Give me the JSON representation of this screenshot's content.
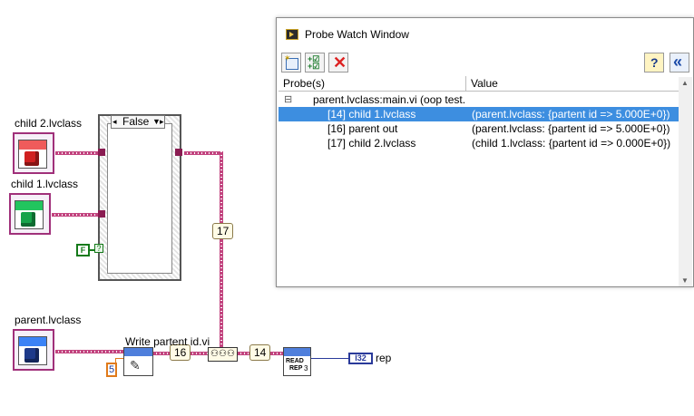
{
  "diagram": {
    "class_labels": {
      "child2": "child 2.lvclass",
      "child1": "child 1.lvclass",
      "parent": "parent.lvclass"
    },
    "case_selector": "False",
    "bool_const": "F",
    "num_const": "5",
    "subvi_label": "Write partent id.vi",
    "probes": {
      "p17": "17",
      "p16": "16",
      "p14": "14"
    },
    "read_rep": {
      "line1": "READ",
      "line2": "REP",
      "line3": "3"
    },
    "i32_label": "I32",
    "rep_label": "rep",
    "colors": {
      "wire": "#c2447f",
      "child2": "#ef5b5b",
      "child1": "#22c55e",
      "parent": "#3b82f6"
    }
  },
  "probe_window": {
    "title": "Probe Watch Window",
    "toolbar": {
      "help": "?",
      "collapse": "«"
    },
    "columns": {
      "probes": "Probe(s)",
      "value": "Value"
    },
    "tree_root": "parent.lvclass:main.vi (oop test.",
    "tree_toggle": "⊟",
    "rows": [
      {
        "probe": "[14] child 1.lvclass",
        "value": "(parent.lvclass: {partent id => 5.000E+0})",
        "selected": true
      },
      {
        "probe": "[16] parent out",
        "value": "(parent.lvclass: {partent id => 5.000E+0})",
        "selected": false
      },
      {
        "probe": "[17] child 2.lvclass",
        "value": "(child 1.lvclass: {partent id => 0.000E+0})",
        "selected": false
      }
    ],
    "accent": "#3d8ee0"
  }
}
